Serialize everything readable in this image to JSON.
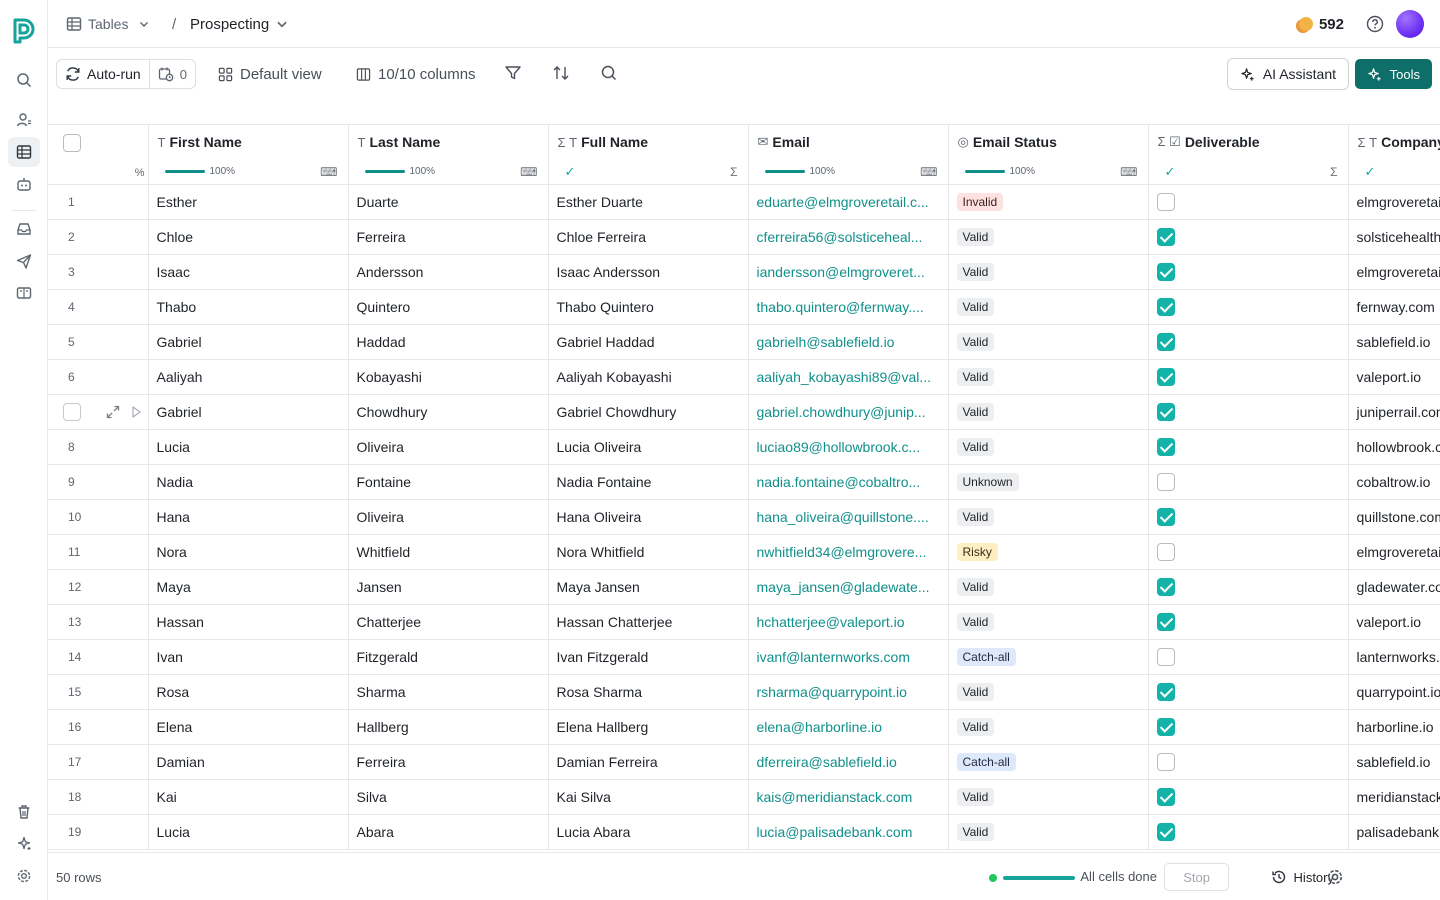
{
  "breadcrumb": {
    "tables_label": "Tables",
    "separator": "/",
    "view_label": "Prospecting"
  },
  "header": {
    "credits": "592"
  },
  "toolbar": {
    "autorun_label": "Auto-run",
    "schedule_count": "0",
    "view_label": "Default view",
    "columns_label": "10/10 columns",
    "ai_label": "AI Assistant",
    "tools_label": "Tools"
  },
  "table": {
    "select_all_pct": "%",
    "columns": [
      {
        "name": "First Name",
        "type_icon": "T",
        "progress": "100%"
      },
      {
        "name": "Last Name",
        "type_icon": "T",
        "progress": "100%"
      },
      {
        "name": "Full Name",
        "type_icon": "Σ T",
        "progress": ""
      },
      {
        "name": "Email",
        "type_icon": "✉",
        "progress": "100%"
      },
      {
        "name": "Email Status",
        "type_icon": "◎",
        "progress": "100%"
      },
      {
        "name": "Deliverable",
        "type_icon": "Σ ☑",
        "progress": ""
      },
      {
        "name": "Company",
        "type_icon": "Σ T",
        "progress": ""
      }
    ],
    "rows": [
      {
        "n": "1",
        "first": "Esther",
        "last": "Duarte",
        "full": "Esther Duarte",
        "email": "eduarte@elmgroveretail.c...",
        "status": "Invalid",
        "deliverable": false,
        "company": "elmgroveretail.com"
      },
      {
        "n": "2",
        "first": "Chloe",
        "last": "Ferreira",
        "full": "Chloe Ferreira",
        "email": "cferreira56@solsticeheal...",
        "status": "Valid",
        "deliverable": true,
        "company": "solsticehealth.com"
      },
      {
        "n": "3",
        "first": "Isaac",
        "last": "Andersson",
        "full": "Isaac Andersson",
        "email": "iandersson@elmgroveret...",
        "status": "Valid",
        "deliverable": true,
        "company": "elmgroveretail.com"
      },
      {
        "n": "4",
        "first": "Thabo",
        "last": "Quintero",
        "full": "Thabo Quintero",
        "email": "thabo.quintero@fernway....",
        "status": "Valid",
        "deliverable": true,
        "company": "fernway.com"
      },
      {
        "n": "5",
        "first": "Gabriel",
        "last": "Haddad",
        "full": "Gabriel Haddad",
        "email": "gabrielh@sablefield.io",
        "status": "Valid",
        "deliverable": true,
        "company": "sablefield.io"
      },
      {
        "n": "6",
        "first": "Aaliyah",
        "last": "Kobayashi",
        "full": "Aaliyah Kobayashi",
        "email": "aaliyah_kobayashi89@val...",
        "status": "Valid",
        "deliverable": true,
        "company": "valeport.io"
      },
      {
        "n": "",
        "first": "Gabriel",
        "last": "Chowdhury",
        "full": "Gabriel Chowdhury",
        "email": "gabriel.chowdhury@junip...",
        "status": "Valid",
        "deliverable": true,
        "company": "juniperrail.com",
        "hover": true
      },
      {
        "n": "8",
        "first": "Lucia",
        "last": "Oliveira",
        "full": "Lucia Oliveira",
        "email": "luciao89@hollowbrook.c...",
        "status": "Valid",
        "deliverable": true,
        "company": "hollowbrook.com"
      },
      {
        "n": "9",
        "first": "Nadia",
        "last": "Fontaine",
        "full": "Nadia Fontaine",
        "email": "nadia.fontaine@cobaltro...",
        "status": "Unknown",
        "deliverable": false,
        "company": "cobaltrow.io"
      },
      {
        "n": "10",
        "first": "Hana",
        "last": "Oliveira",
        "full": "Hana Oliveira",
        "email": "hana_oliveira@quillstone....",
        "status": "Valid",
        "deliverable": true,
        "company": "quillstone.com"
      },
      {
        "n": "11",
        "first": "Nora",
        "last": "Whitfield",
        "full": "Nora Whitfield",
        "email": "nwhitfield34@elmgrovere...",
        "status": "Risky",
        "deliverable": false,
        "company": "elmgroveretail.com"
      },
      {
        "n": "12",
        "first": "Maya",
        "last": "Jansen",
        "full": "Maya Jansen",
        "email": "maya_jansen@gladewate...",
        "status": "Valid",
        "deliverable": true,
        "company": "gladewater.com"
      },
      {
        "n": "13",
        "first": "Hassan",
        "last": "Chatterjee",
        "full": "Hassan Chatterjee",
        "email": "hchatterjee@valeport.io",
        "status": "Valid",
        "deliverable": true,
        "company": "valeport.io"
      },
      {
        "n": "14",
        "first": "Ivan",
        "last": "Fitzgerald",
        "full": "Ivan Fitzgerald",
        "email": "ivanf@lanternworks.com",
        "status": "Catch-all",
        "deliverable": false,
        "company": "lanternworks.com"
      },
      {
        "n": "15",
        "first": "Rosa",
        "last": "Sharma",
        "full": "Rosa Sharma",
        "email": "rsharma@quarrypoint.io",
        "status": "Valid",
        "deliverable": true,
        "company": "quarrypoint.io"
      },
      {
        "n": "16",
        "first": "Elena",
        "last": "Hallberg",
        "full": "Elena Hallberg",
        "email": "elena@harborline.io",
        "status": "Valid",
        "deliverable": true,
        "company": "harborline.io"
      },
      {
        "n": "17",
        "first": "Damian",
        "last": "Ferreira",
        "full": "Damian Ferreira",
        "email": "dferreira@sablefield.io",
        "status": "Catch-all",
        "deliverable": false,
        "company": "sablefield.io"
      },
      {
        "n": "18",
        "first": "Kai",
        "last": "Silva",
        "full": "Kai Silva",
        "email": "kais@meridianstack.com",
        "status": "Valid",
        "deliverable": true,
        "company": "meridianstack.com"
      },
      {
        "n": "19",
        "first": "Lucia",
        "last": "Abara",
        "full": "Lucia Abara",
        "email": "lucia@palisadebank.com",
        "status": "Valid",
        "deliverable": true,
        "company": "palisadebank.com"
      }
    ]
  },
  "footer": {
    "rows_label": "50 rows",
    "status_label": "All cells done",
    "stop_label": "Stop",
    "history_label": "History"
  },
  "colors": {
    "accent": "#0e6f6a",
    "link": "#10908a",
    "check": "#14b3aa"
  }
}
